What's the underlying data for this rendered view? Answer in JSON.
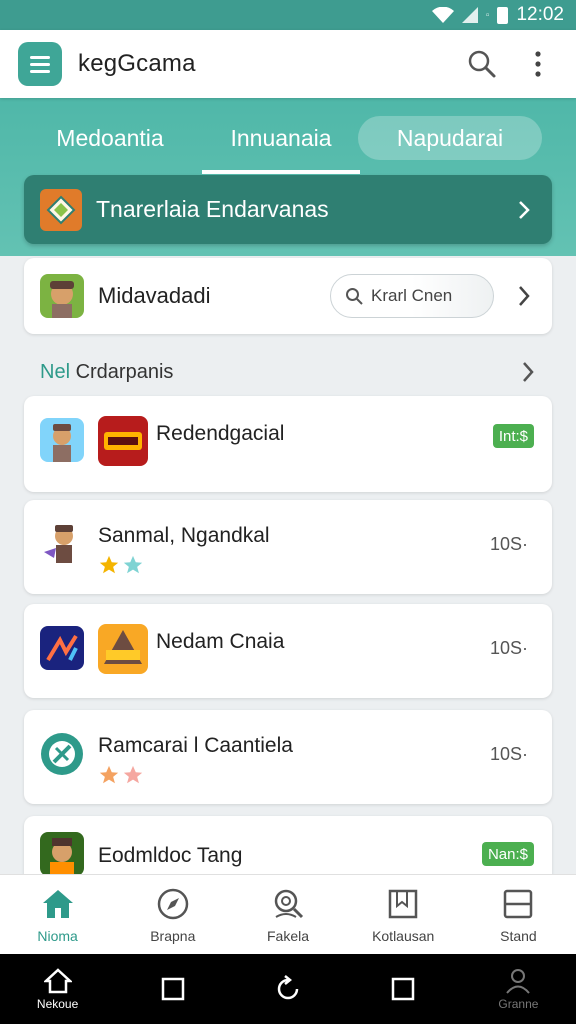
{
  "status_bar": {
    "time": "12:02"
  },
  "app_bar": {
    "title": "kegGcama"
  },
  "tabs": [
    {
      "label": "Medoantia"
    },
    {
      "label": "Innuanaia"
    },
    {
      "label": "Napudarai"
    }
  ],
  "banner": {
    "text": "Tnarerlaia Endarvanas"
  },
  "feature": {
    "title": "Midavadadi",
    "search_label": "Krarl Cnen"
  },
  "section": {
    "title_accent": "Nel",
    "title_rest": " Crdarpanis"
  },
  "list": [
    {
      "title": "Redendgacial",
      "badge": "Int:$"
    },
    {
      "title": "Sanmal, Ngandkal",
      "count": "10S·"
    },
    {
      "title": "Nedam Cnaia",
      "count": "10S·"
    },
    {
      "title": "Ramcarai l Caantiela",
      "count": "10S·"
    },
    {
      "title": "Eodmldoc Tang",
      "badge": "Nan:$"
    }
  ],
  "bottom_nav": [
    {
      "label": "Nioma",
      "icon": "home-icon"
    },
    {
      "label": "Brapna",
      "icon": "compass-icon"
    },
    {
      "label": "Fakela",
      "icon": "search-person-icon"
    },
    {
      "label": "Kotlausan",
      "icon": "bookmark-book-icon"
    },
    {
      "label": "Stand",
      "icon": "window-icon"
    }
  ],
  "system_nav": [
    {
      "label": "Nekoue"
    },
    {
      "label": "Granne"
    }
  ],
  "colors": {
    "accent": "#3fa697",
    "accent_dark": "#2f7f72",
    "badge_green": "#4caf50"
  }
}
